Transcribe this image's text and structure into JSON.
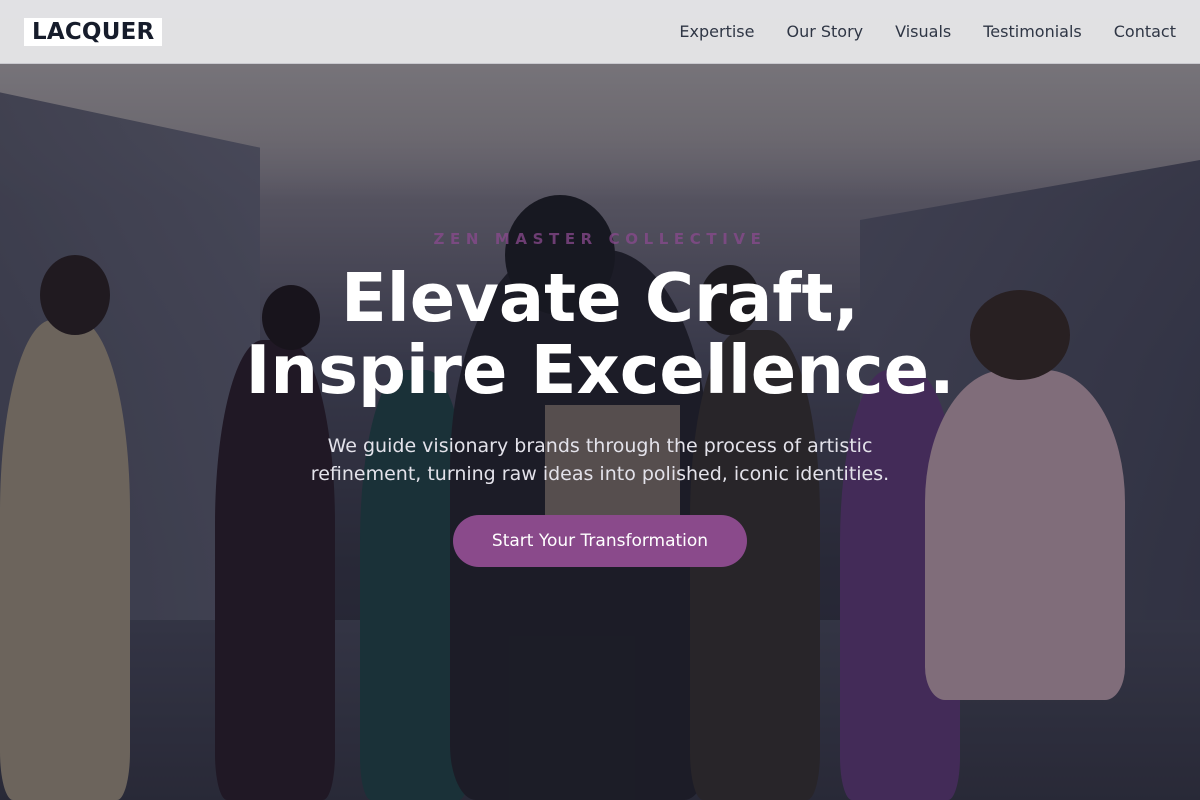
{
  "brand": {
    "logo_text": "LACQUER"
  },
  "nav": {
    "links": [
      "Expertise",
      "Our Story",
      "Visuals",
      "Testimonials",
      "Contact"
    ]
  },
  "hero": {
    "eyebrow": "ZEN MASTER COLLECTIVE",
    "headline_line1": "Elevate Craft,",
    "headline_line2": "Inspire Excellence.",
    "subtext": "We guide visionary brands through the process of artistic refinement, turning raw ideas into polished, iconic identities.",
    "cta_label": "Start Your Transformation"
  },
  "colors": {
    "accent": "#8a4a8b",
    "navbar_bg": "#e8e8ea",
    "text_dark": "#161c2b",
    "headline": "#ffffff"
  }
}
